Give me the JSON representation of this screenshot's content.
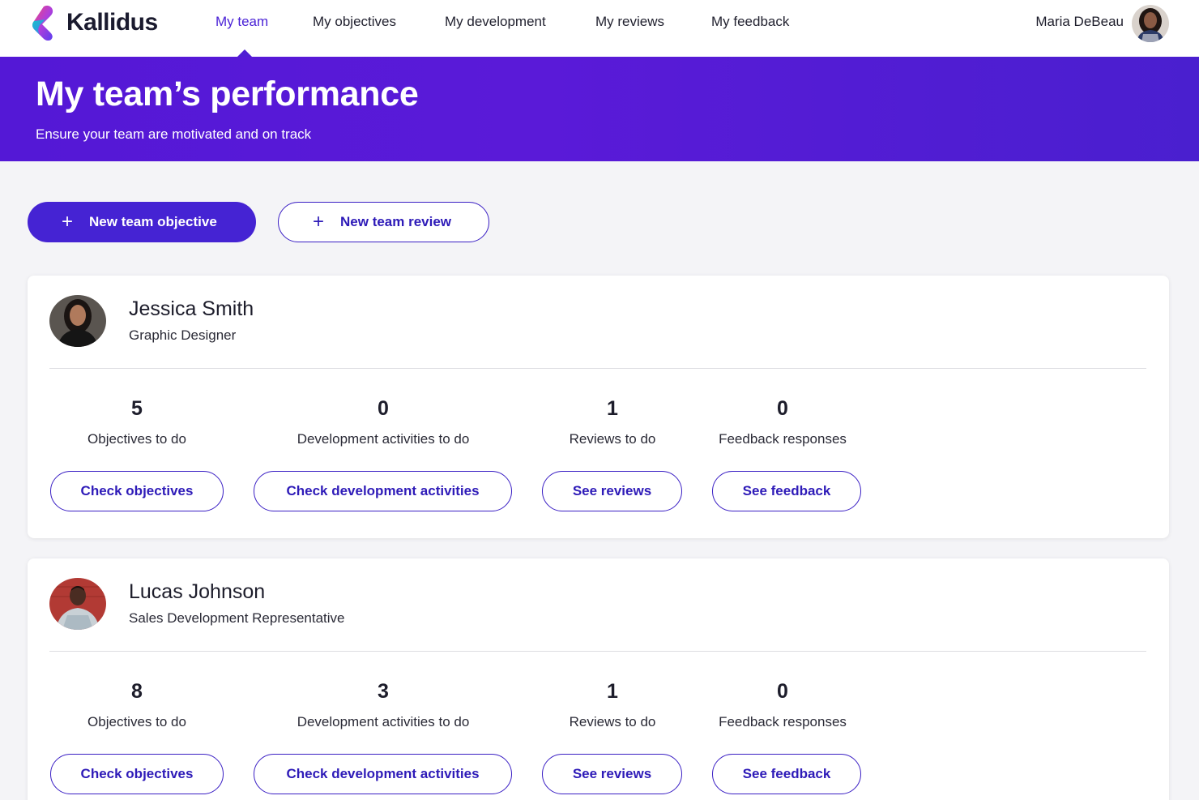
{
  "app": {
    "brand": "Kallidus",
    "colors": {
      "accent": "#4a22d6",
      "banner": "#5418d6",
      "button_primary": "#4523d3"
    }
  },
  "nav": {
    "items": [
      {
        "label": "My team",
        "active": true
      },
      {
        "label": "My objectives",
        "active": false
      },
      {
        "label": "My development",
        "active": false
      },
      {
        "label": "My reviews",
        "active": false
      },
      {
        "label": "My feedback",
        "active": false
      }
    ],
    "user_name": "Maria DeBeau"
  },
  "banner": {
    "title": "My team’s performance",
    "subtitle": "Ensure your team are motivated and on track"
  },
  "actions": {
    "new_objective": "New team objective",
    "new_review": "New team review",
    "plus_icon": "+"
  },
  "members": [
    {
      "name": "Jessica Smith",
      "role": "Graphic Designer",
      "stats": [
        {
          "value": "5",
          "label": "Objectives to do",
          "button": "Check objectives"
        },
        {
          "value": "0",
          "label": "Development activities to do",
          "button": "Check development activities"
        },
        {
          "value": "1",
          "label": "Reviews to do",
          "button": "See reviews"
        },
        {
          "value": "0",
          "label": "Feedback responses",
          "button": "See feedback"
        }
      ]
    },
    {
      "name": "Lucas Johnson",
      "role": "Sales Development Representative",
      "stats": [
        {
          "value": "8",
          "label": "Objectives to do",
          "button": "Check objectives"
        },
        {
          "value": "3",
          "label": "Development activities to do",
          "button": "Check development activities"
        },
        {
          "value": "1",
          "label": "Reviews to do",
          "button": "See reviews"
        },
        {
          "value": "0",
          "label": "Feedback responses",
          "button": "See feedback"
        }
      ]
    }
  ]
}
